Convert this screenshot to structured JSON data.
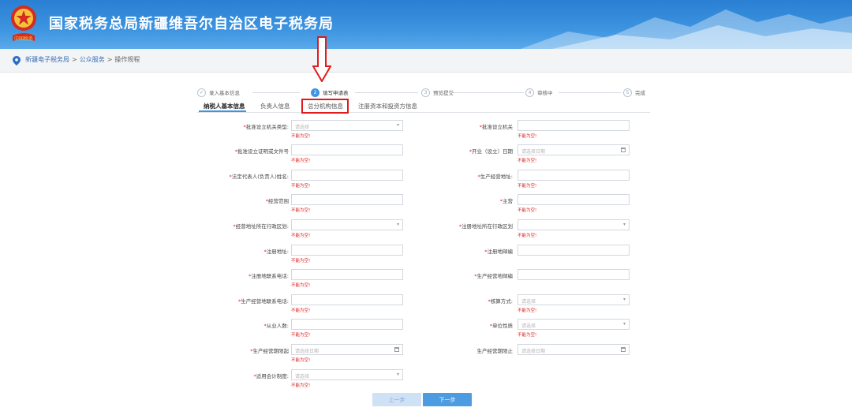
{
  "header": {
    "title": "国家税务总局新疆维吾尔自治区电子税务局",
    "emblem_text": "中国税务",
    "colors": {
      "bar": "#3d94e0",
      "accent": "#e01b1b"
    }
  },
  "breadcrumb": {
    "items": [
      "新疆电子税务局",
      "公众服务",
      "操作规程"
    ],
    "separator": ">"
  },
  "stepper": {
    "steps": [
      {
        "num": "✓",
        "label": "录入基本信息",
        "state": "done"
      },
      {
        "num": "2",
        "label": "填写申请表",
        "state": "active"
      },
      {
        "num": "3",
        "label": "预览提交",
        "state": "todo"
      },
      {
        "num": "4",
        "label": "审核中",
        "state": "todo"
      },
      {
        "num": "5",
        "label": "完成",
        "state": "todo"
      }
    ]
  },
  "tabs": {
    "items": [
      "纳税人基本信息",
      "负责人信息",
      "总分机构信息",
      "注册资本和投资方信息"
    ],
    "active_index": 0,
    "highlighted_index": 2
  },
  "form": {
    "error_text": "不能为空!",
    "fields": [
      {
        "label": "批准设立机关类型:",
        "required": true,
        "type": "select",
        "placeholder": "请选择",
        "error": true
      },
      {
        "label": "批准设立机关",
        "required": true,
        "type": "text",
        "placeholder": "",
        "error": true
      },
      {
        "label": "批准设立证明或文件号",
        "required": true,
        "type": "text",
        "placeholder": "",
        "error": true
      },
      {
        "label": "开业（设立）日期",
        "required": true,
        "type": "date",
        "placeholder": "请选择日期",
        "error": true
      },
      {
        "label": "法定代表人(负责人)姓名:",
        "required": true,
        "type": "text",
        "placeholder": "",
        "error": true
      },
      {
        "label": "生产经营地址:",
        "required": true,
        "type": "text",
        "placeholder": "",
        "error": true
      },
      {
        "label": "经营范围",
        "required": true,
        "type": "text",
        "placeholder": "",
        "error": true
      },
      {
        "label": "主营",
        "required": true,
        "type": "text",
        "placeholder": "",
        "error": true
      },
      {
        "label": "经营地址所在行政区划:",
        "required": true,
        "type": "select",
        "placeholder": "",
        "error": true
      },
      {
        "label": "注册地址所在行政区划",
        "required": true,
        "type": "select",
        "placeholder": "",
        "error": true
      },
      {
        "label": "注册地址:",
        "required": true,
        "type": "text",
        "placeholder": "",
        "error": true
      },
      {
        "label": "注册地邮编",
        "required": true,
        "type": "text",
        "placeholder": "",
        "error": false
      },
      {
        "label": "注册地联系电话:",
        "required": true,
        "type": "text",
        "placeholder": "",
        "error": true
      },
      {
        "label": "生产经营地邮编",
        "required": true,
        "type": "text",
        "placeholder": "",
        "error": false
      },
      {
        "label": "生产经营地联系电话:",
        "required": true,
        "type": "text",
        "placeholder": "",
        "error": true
      },
      {
        "label": "核算方式:",
        "required": true,
        "type": "select",
        "placeholder": "请选择",
        "error": true
      },
      {
        "label": "从业人数:",
        "required": true,
        "type": "text",
        "placeholder": "",
        "error": true
      },
      {
        "label": "单位性质",
        "required": true,
        "type": "select",
        "placeholder": "请选择",
        "error": true
      },
      {
        "label": "生产经营期限起",
        "required": true,
        "type": "date",
        "placeholder": "请选择日期",
        "error": true
      },
      {
        "label": "生产经营期限止",
        "required": false,
        "type": "date",
        "placeholder": "请选择日期",
        "error": false
      },
      {
        "label": "适用会计制度:",
        "required": true,
        "type": "select",
        "placeholder": "请选择",
        "error": true
      }
    ]
  },
  "buttons": {
    "prev": "上一步",
    "next": "下一步"
  }
}
